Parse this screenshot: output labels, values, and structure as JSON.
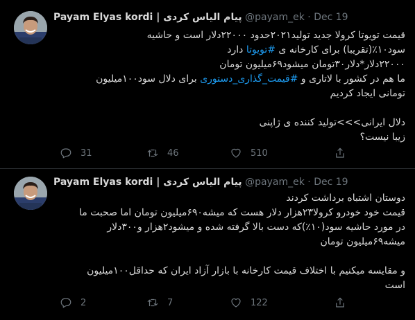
{
  "tweets": [
    {
      "name": "Payam Elyas kordi | پیام الیاس کردی",
      "handle": "@payam_ek",
      "separator": "·",
      "date": "Dec 19",
      "lines": [
        "قیمت تویوتا کرولا جدید تولید۲۰۲۱حدود ۲۲۰۰۰دلار است و حاشیه",
        "سود۱۰٪(تقریبا) برای کارخانه ی #تویوتا دارد",
        "۲۲۰۰۰دلار*دلار۳۰تومان میشود۶۹میلیون تومان",
        "ما هم در کشور با لاتاری و #قیمت_گذاری_دستوری برای دلال سود۱۰۰میلیون",
        "تومانی ایجاد کردیم",
        "",
        "دلال ایرانی>>>تولید کننده ی ژاپنی",
        "زیبا نیست؟"
      ],
      "hashtag_1": "#تویوتا",
      "hashtag_2": "#قیمت_گذاری_دستوری",
      "reply_count": "31",
      "retweet_count": "46",
      "like_count": "510"
    },
    {
      "name": "Payam Elyas kordi | پیام الیاس کردی",
      "handle": "@payam_ek",
      "separator": "·",
      "date": "Dec 19",
      "lines": [
        "دوستان اشتباه برداشت کردند",
        "قیمت خود خودرو کرولا۲۳هزار دلار هست که میشه۶۹۰میلیون تومان اما صحبت ما",
        "در مورد حاشیه سود(۱۰٪)که دست بالا گرفته شده و میشود۲هزار و۳۰۰دلار",
        "میشه۶۹میلیون تومان",
        "",
        "و مقایسه میکنیم با اختلاف قیمت کارخانه با بازار آزاد ایران که حداقل۱۰۰میلیون",
        "است"
      ],
      "reply_count": "2",
      "retweet_count": "7",
      "like_count": "122"
    }
  ],
  "colors": {
    "background": "#000000",
    "text": "#d9d9d9",
    "muted": "#6e767d",
    "link": "#1d9bf0",
    "divider": "#2f3336"
  },
  "icons": [
    "reply-icon",
    "retweet-icon",
    "like-icon",
    "share-icon"
  ]
}
